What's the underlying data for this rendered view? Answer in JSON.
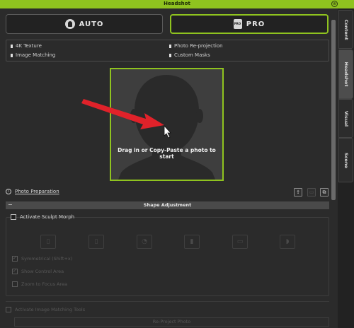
{
  "window": {
    "title": "Headshot",
    "close_glyph": "⊗"
  },
  "modes": [
    {
      "label": "AUTO",
      "icon": "auto-face-icon",
      "selected": false
    },
    {
      "label": "PRO",
      "icon": "pro-badge-icon",
      "selected": true
    }
  ],
  "features": [
    "4K Texture",
    "Photo Re-projection",
    "Image Matching",
    "Custom Masks"
  ],
  "photo_drop": {
    "hint": "Drag in or Copy-Paste a photo to start"
  },
  "photo_preparation": {
    "info_glyph": "i",
    "link": "Photo Preparation"
  },
  "toolbar_glyphs": {
    "load": "⇪",
    "save": "▭",
    "copy": "⧉"
  },
  "shape_adjustment": {
    "collapse_glyph": "−",
    "title": "Shape Adjustment",
    "activate_sculpt_morph": "Activate Sculpt Morph",
    "tools": [
      "▯",
      "▯",
      "◔",
      "▮",
      "▭",
      "◗"
    ],
    "options": [
      "Symmetrical (Shift+x)",
      "Show Control Area",
      "Zoom to Focus Area"
    ]
  },
  "image_matching": {
    "activate": "Activate Image Matching Tools",
    "reproject_button": "Re-Project Photo"
  },
  "side_tabs": [
    {
      "label": "Content",
      "active": false
    },
    {
      "label": "Headshot",
      "active": true
    },
    {
      "label": "Visual",
      "active": false
    },
    {
      "label": "Scene",
      "active": false
    }
  ],
  "colors": {
    "accent": "#8fc31f",
    "background": "#2b2b2b",
    "arrow": "#e0222a"
  }
}
